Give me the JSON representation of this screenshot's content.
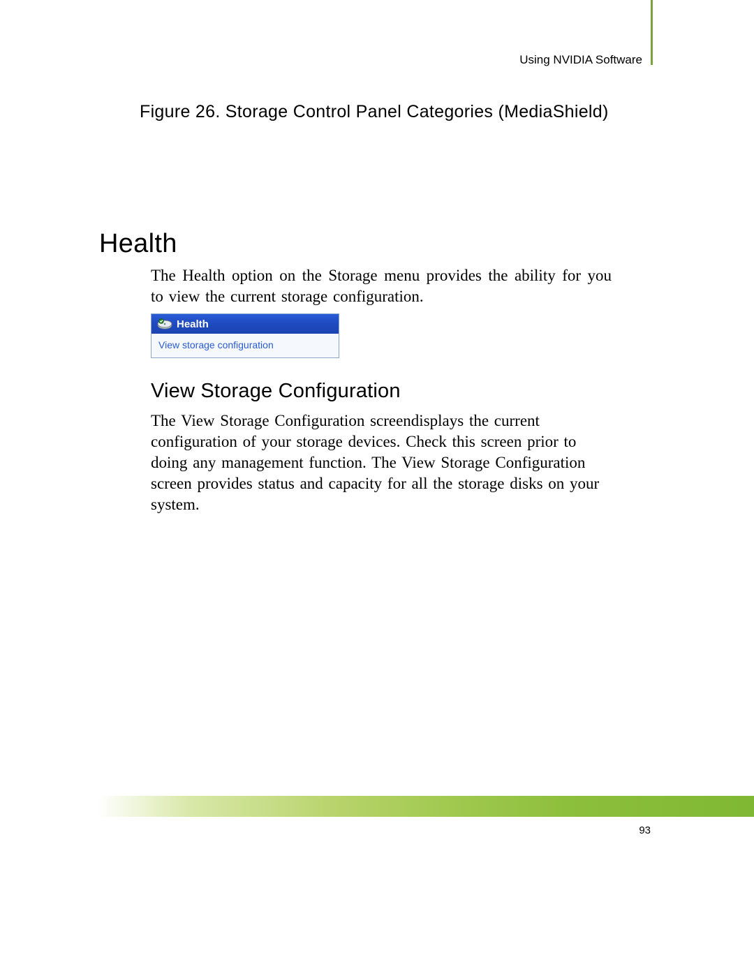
{
  "runningHead": "Using NVIDIA Software",
  "figureCaption": "Figure 26.  Storage Control Panel Categories (MediaShield)",
  "section": {
    "title": "Health",
    "intro": "The Health option on the Storage menu provides the ability for you to view the current storage configuration.",
    "panel": {
      "header": "Health",
      "link": "View storage configuration"
    },
    "subTitle": "View Storage Configuration",
    "body": "The View Storage Configuration screendisplays the current configuration of your storage devices. Check this screen prior to doing any management function. The View Storage Configuration screen provides status and capacity for all the storage disks on your system."
  },
  "pageNumber": "93"
}
